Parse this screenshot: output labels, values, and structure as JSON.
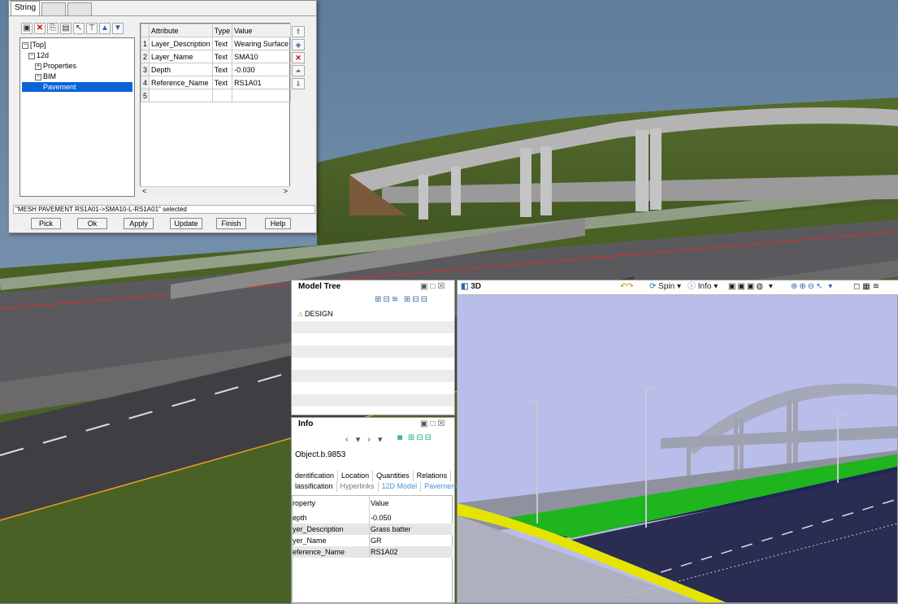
{
  "dialog": {
    "tabs": [
      "String",
      "",
      ""
    ],
    "toolbar_icons": [
      "new-icon",
      "delete-icon",
      "copy-icon",
      "paste-icon",
      "pointer-icon",
      "filter-icon",
      "up-icon",
      "down-icon"
    ],
    "tree": [
      {
        "label": "[Top]",
        "toggle": "−",
        "indent": 0
      },
      {
        "label": "12d",
        "toggle": "−",
        "indent": 1
      },
      {
        "label": "Properties",
        "toggle": "+",
        "indent": 2
      },
      {
        "label": "BIM",
        "toggle": "−",
        "indent": 2
      },
      {
        "label": "Pavement",
        "toggle": "",
        "indent": 3
      }
    ],
    "grid": {
      "headers": [
        "Attribute",
        "Type",
        "Value"
      ],
      "rows": [
        {
          "n": "1",
          "attribute": "Layer_Description",
          "type": "Text",
          "value": "Wearing Surface"
        },
        {
          "n": "2",
          "attribute": "Layer_Name",
          "type": "Text",
          "value": "SMA10"
        },
        {
          "n": "3",
          "attribute": "Depth",
          "type": "Text",
          "value": "-0.030"
        },
        {
          "n": "4",
          "attribute": "Reference_Name",
          "type": "Text",
          "value": "RS1A01"
        },
        {
          "n": "5",
          "attribute": "",
          "type": "",
          "value": ""
        }
      ]
    },
    "status": "\"MESH PAVEMENT RS1A01->SMA10-L-RS1A01\" selected",
    "buttons": {
      "pick": "Pick",
      "ok": "Ok",
      "apply": "Apply",
      "update": "Update",
      "finish": "Finish",
      "help": "Help"
    }
  },
  "model_tree": {
    "title": "Model Tree",
    "root": "DESIGN"
  },
  "info": {
    "title": "Info",
    "object": "Object.b.9853",
    "tabs_row1": [
      "dentification",
      "Location",
      "Quantities",
      "Relations"
    ],
    "tabs_row2": [
      "lassification",
      "Hyperlinks",
      "12D Model",
      "Pavement"
    ],
    "header": {
      "property": "roperty",
      "value": "Value"
    },
    "rows": [
      {
        "property": "epth",
        "value": "-0.050"
      },
      {
        "property": "yer_Description",
        "value": "Grass batter"
      },
      {
        "property": "yer_Name",
        "value": "GR"
      },
      {
        "property": "eference_Name",
        "value": "RS1A02"
      }
    ]
  },
  "view3d": {
    "title": "3D",
    "spin": "Spin",
    "info": "Info"
  }
}
